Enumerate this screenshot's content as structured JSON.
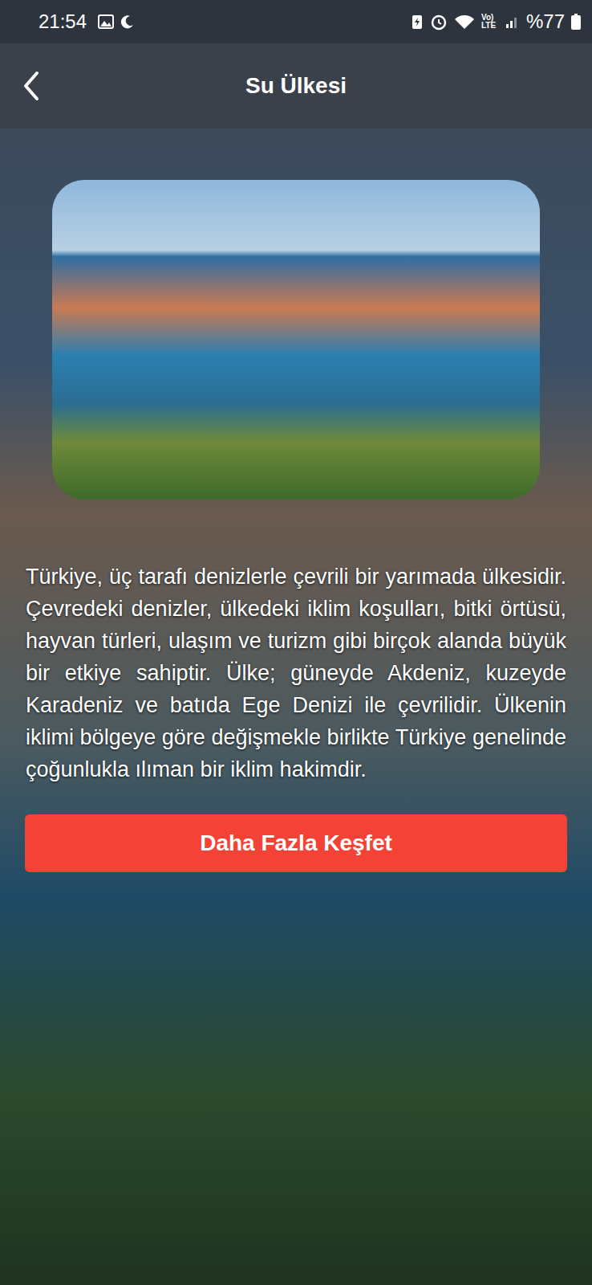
{
  "status_bar": {
    "time": "21:54",
    "network": "Vo) LTE",
    "battery": "%77"
  },
  "header": {
    "title": "Su Ülkesi"
  },
  "content": {
    "paragraph": "Türkiye, üç tarafı denizlerle çevrili bir yarımada ülkesidir. Çevredeki denizler, ülkedeki iklim koşulları, bitki örtüsü, hayvan türleri, ulaşım ve turizm gibi birçok alanda büyük bir etkiye sahiptir. Ülke; güneyde Akdeniz, kuzeyde Karadeniz ve batıda Ege Denizi ile çevrilidir. Ülkenin iklimi bölgeye göre değişmekle birlikte Türkiye genelinde çoğunlukla ılıman bir iklim hakimdir."
  },
  "buttons": [
    "Daha Fazla Keşfet"
  ]
}
